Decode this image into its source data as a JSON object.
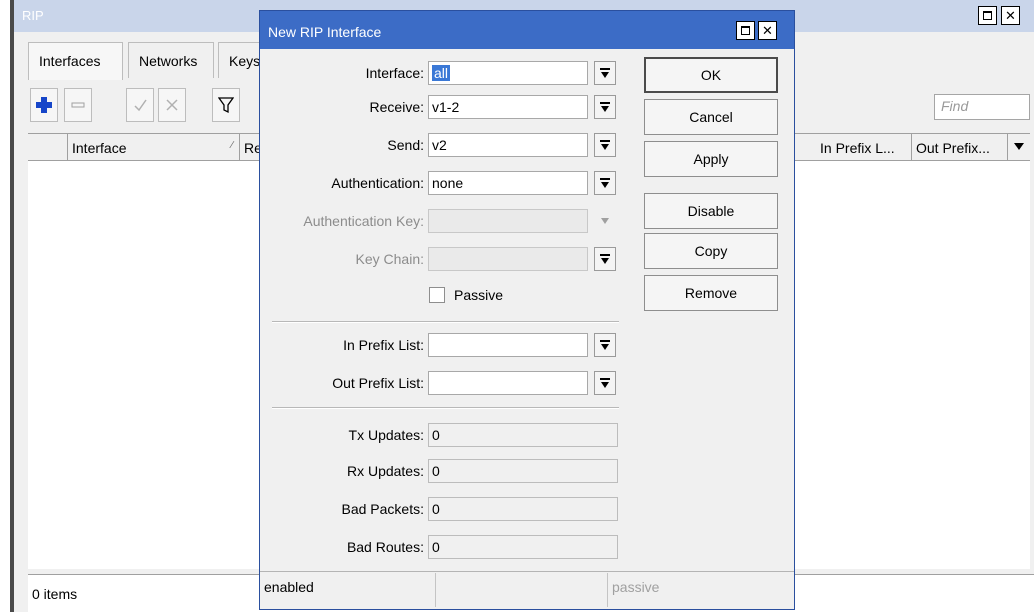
{
  "rip_window": {
    "title": "RIP",
    "tabs": [
      {
        "label": "Interfaces"
      },
      {
        "label": "Networks"
      },
      {
        "label": "Keys"
      }
    ],
    "find_placeholder": "Find",
    "columns": [
      {
        "label": "Interface"
      },
      {
        "label": "Rec"
      },
      {
        "label": "In Prefix L..."
      },
      {
        "label": "Out Prefix..."
      }
    ],
    "sort_indicator": "∕",
    "status": "0 items"
  },
  "dialog": {
    "title": "New RIP Interface",
    "fields": {
      "interface": {
        "label": "Interface:",
        "value": "all"
      },
      "receive": {
        "label": "Receive:",
        "value": "v1-2"
      },
      "send": {
        "label": "Send:",
        "value": "v2"
      },
      "authentication": {
        "label": "Authentication:",
        "value": "none"
      },
      "authentication_key": {
        "label": "Authentication Key:",
        "value": ""
      },
      "key_chain": {
        "label": "Key Chain:",
        "value": ""
      },
      "passive": {
        "label": "Passive",
        "checked": false
      },
      "in_prefix_list": {
        "label": "In Prefix List:",
        "value": ""
      },
      "out_prefix_list": {
        "label": "Out Prefix List:",
        "value": ""
      },
      "tx_updates": {
        "label": "Tx Updates:",
        "value": "0"
      },
      "rx_updates": {
        "label": "Rx Updates:",
        "value": "0"
      },
      "bad_packets": {
        "label": "Bad Packets:",
        "value": "0"
      },
      "bad_routes": {
        "label": "Bad Routes:",
        "value": "0"
      }
    },
    "buttons": {
      "ok": "OK",
      "cancel": "Cancel",
      "apply": "Apply",
      "disable": "Disable",
      "copy": "Copy",
      "remove": "Remove"
    },
    "status": {
      "enabled": "enabled",
      "middle": "",
      "passive": "passive"
    }
  },
  "colors": {
    "dialog_titlebar": "#3c6cc6",
    "rip_titlebar": "#c9d5ea",
    "add_icon": "#1746c9",
    "selection": "#3a78d6"
  },
  "icons": [
    "add-icon",
    "remove-icon",
    "enable-icon",
    "disable-icon",
    "filter-icon",
    "dropdown-icon",
    "minimize-icon",
    "close-icon"
  ]
}
